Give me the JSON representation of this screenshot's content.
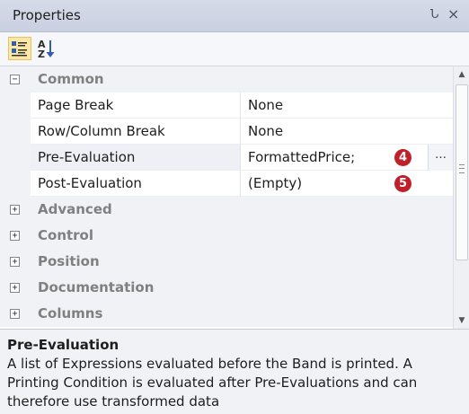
{
  "window": {
    "title": "Properties",
    "pin_glyph": "Ն",
    "close_glyph": "×"
  },
  "toolbar": {
    "categorized_icon": "categorized-icon",
    "alphabetical_icon": "sort-alphabetical-icon"
  },
  "grid": {
    "categories": [
      {
        "label": "Common",
        "expanded": true,
        "glyph": "−"
      },
      {
        "label": "Advanced",
        "expanded": false,
        "glyph": "+"
      },
      {
        "label": "Control",
        "expanded": false,
        "glyph": "+"
      },
      {
        "label": "Position",
        "expanded": false,
        "glyph": "+"
      },
      {
        "label": "Documentation",
        "expanded": false,
        "glyph": "+"
      },
      {
        "label": "Columns",
        "expanded": false,
        "glyph": "+"
      }
    ],
    "properties": [
      {
        "name": "Page Break",
        "value": "None"
      },
      {
        "name": "Row/Column Break",
        "value": "None"
      },
      {
        "name": "Pre-Evaluation",
        "value": "FormattedPrice;",
        "button": "…",
        "badge": "4"
      },
      {
        "name": "Post-Evaluation",
        "value": "(Empty)",
        "badge": "5"
      }
    ]
  },
  "description": {
    "title": "Pre-Evaluation",
    "text": "A list of Expressions evaluated before the Band is printed. A Printing Condition is evaluated after Pre-Evaluations and can therefore use transformed data"
  },
  "colors": {
    "badge": "#c0202a",
    "titlebar": "#d6dbe9",
    "category_text": "#808080"
  }
}
